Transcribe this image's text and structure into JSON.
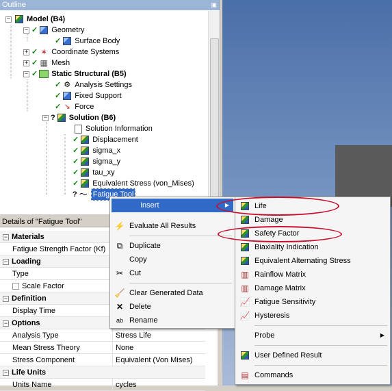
{
  "outline": {
    "title": "Outline",
    "pin": "p",
    "nodes": [
      {
        "label": "Model (B4)",
        "bold": true
      },
      {
        "label": "Geometry"
      },
      {
        "label": "Surface Body"
      },
      {
        "label": "Coordinate Systems"
      },
      {
        "label": "Mesh"
      },
      {
        "label": "Static Structural (B5)",
        "bold": true
      },
      {
        "label": "Analysis Settings"
      },
      {
        "label": "Fixed Support"
      },
      {
        "label": "Force"
      },
      {
        "label": "Solution (B6)",
        "bold": true
      },
      {
        "label": "Solution Information"
      },
      {
        "label": "Displacement"
      },
      {
        "label": "sigma_x"
      },
      {
        "label": "sigma_y"
      },
      {
        "label": "tau_xy"
      },
      {
        "label": "Equivalent Stress (von_Mises)"
      },
      {
        "label": "Fatigue Tool"
      }
    ]
  },
  "details": {
    "title": "Details of \"Fatigue Tool\"",
    "rows": [
      {
        "key": "Materials",
        "value": "",
        "group": true
      },
      {
        "key": "Fatigue Strength Factor (Kf)",
        "value": ""
      },
      {
        "key": "Loading",
        "value": "",
        "group": true
      },
      {
        "key": "Type",
        "value": ""
      },
      {
        "key": "Scale Factor",
        "value": ""
      },
      {
        "key": "Definition",
        "value": "",
        "group": true
      },
      {
        "key": "Display Time",
        "value": ""
      },
      {
        "key": "Options",
        "value": "",
        "group": true
      },
      {
        "key": "Analysis Type",
        "value": "Stress Life"
      },
      {
        "key": "Mean Stress Theory",
        "value": "None"
      },
      {
        "key": "Stress Component",
        "value": "Equivalent (Von Mises)"
      },
      {
        "key": "Life Units",
        "value": "",
        "group": true
      },
      {
        "key": "Units Name",
        "value": "cycles"
      }
    ]
  },
  "context_menu": {
    "items": [
      {
        "label": "Insert",
        "icon": "none",
        "submenu": true
      },
      {
        "label": "Evaluate All Results",
        "icon": "lightning-icon"
      },
      {
        "label": "Duplicate",
        "icon": "duplicate-icon"
      },
      {
        "label": "Copy",
        "icon": "copy-icon"
      },
      {
        "label": "Cut",
        "icon": "cut-icon"
      },
      {
        "label": "Clear Generated Data",
        "icon": "clear-data-icon"
      },
      {
        "label": "Delete",
        "icon": "delete-icon"
      },
      {
        "label": "Rename",
        "icon": "rename-icon"
      }
    ]
  },
  "insert_submenu": {
    "items": [
      {
        "label": "Life"
      },
      {
        "label": "Damage"
      },
      {
        "label": "Safety Factor"
      },
      {
        "label": "Biaxiality Indication"
      },
      {
        "label": "Equivalent Alternating Stress"
      },
      {
        "label": "Rainflow Matrix"
      },
      {
        "label": "Damage Matrix"
      },
      {
        "label": "Fatigue Sensitivity"
      },
      {
        "label": "Hysteresis"
      },
      {
        "label": "Probe"
      },
      {
        "label": "User Defined Result"
      },
      {
        "label": "Commands"
      }
    ]
  },
  "colors": {
    "highlight": "#3169c6",
    "annotation": "#c8102e"
  }
}
